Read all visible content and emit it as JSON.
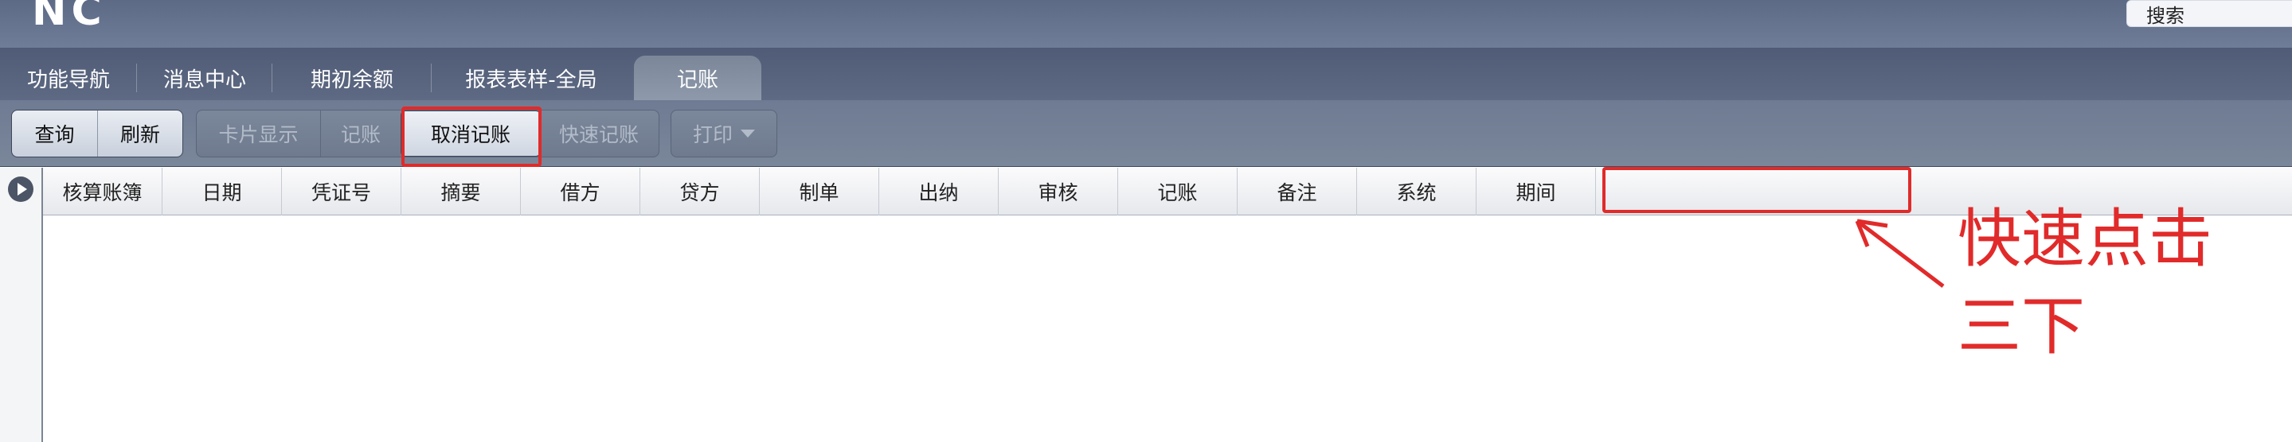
{
  "header": {
    "logo_text": "NC",
    "search_label": "搜索"
  },
  "tabs": [
    {
      "label": "功能导航"
    },
    {
      "label": "消息中心"
    },
    {
      "label": "期初余额"
    },
    {
      "label": "报表表样-全局"
    },
    {
      "label": "记账",
      "active": true
    }
  ],
  "toolbar": {
    "query": "查询",
    "refresh": "刷新",
    "card_view": "卡片显示",
    "post": "记账",
    "cancel_post": "取消记账",
    "quick_post": "快速记账",
    "print": "打印"
  },
  "table": {
    "columns": [
      "核算账簿",
      "日期",
      "凭证号",
      "摘要",
      "借方",
      "贷方",
      "制单",
      "出纳",
      "审核",
      "记账",
      "备注",
      "系统",
      "期间"
    ],
    "rows": []
  },
  "annotation": {
    "text_line1": "快速点击",
    "text_line2": "三下",
    "color": "#e12a2a"
  }
}
